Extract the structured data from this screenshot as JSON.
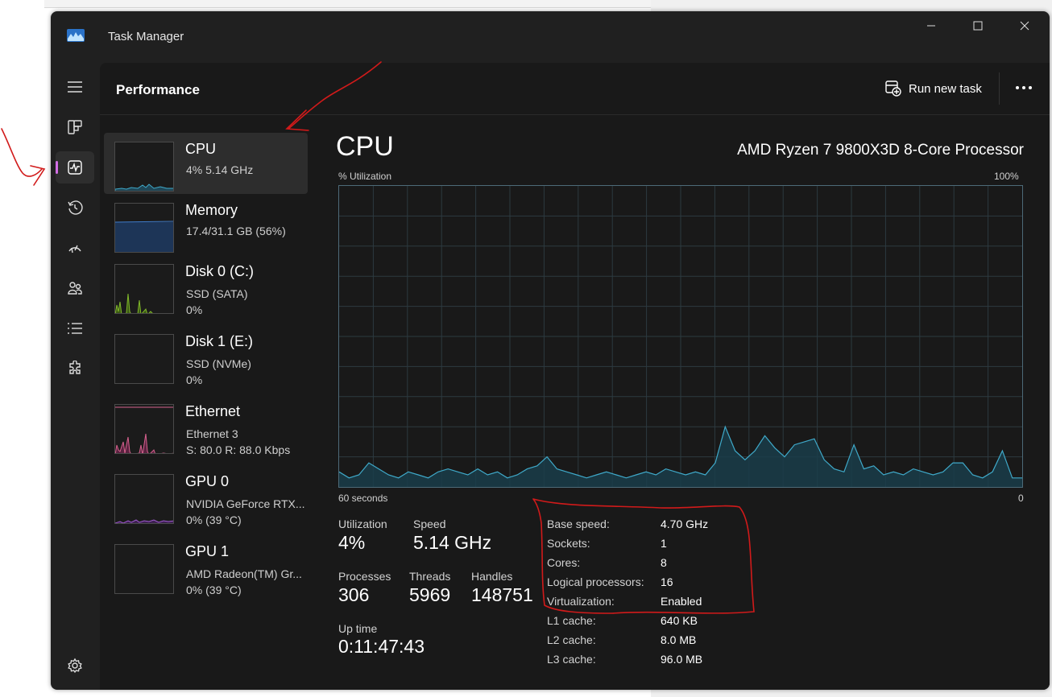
{
  "window": {
    "title": "Task Manager",
    "page_title": "Performance",
    "run_new_task": "Run new task"
  },
  "nav": {
    "items": [
      {
        "name": "menu",
        "icon": "hamburger-icon"
      },
      {
        "name": "processes",
        "icon": "processes-icon"
      },
      {
        "name": "performance",
        "icon": "performance-icon",
        "active": true
      },
      {
        "name": "app-history",
        "icon": "history-icon"
      },
      {
        "name": "startup-apps",
        "icon": "speedometer-icon"
      },
      {
        "name": "users",
        "icon": "users-icon"
      },
      {
        "name": "details",
        "icon": "list-icon"
      },
      {
        "name": "services",
        "icon": "puzzle-icon"
      },
      {
        "name": "settings",
        "icon": "gear-icon"
      }
    ]
  },
  "devices": [
    {
      "name": "CPU",
      "sub1": "4%  5.14 GHz",
      "sub2": "",
      "color": "#3fa9c9",
      "active": true
    },
    {
      "name": "Memory",
      "sub1": "17.4/31.1 GB (56%)",
      "sub2": "",
      "color": "#3f7ccb"
    },
    {
      "name": "Disk 0 (C:)",
      "sub1": "SSD (SATA)",
      "sub2": "0%",
      "color": "#80b82a"
    },
    {
      "name": "Disk 1 (E:)",
      "sub1": "SSD (NVMe)",
      "sub2": "0%",
      "color": "#80b82a"
    },
    {
      "name": "Ethernet",
      "sub1": "Ethernet 3",
      "sub2": "S: 80.0  R: 88.0 Kbps",
      "color": "#d6618e"
    },
    {
      "name": "GPU 0",
      "sub1": "NVIDIA GeForce RTX...",
      "sub2": "0%  (39 °C)",
      "color": "#a05ad0"
    },
    {
      "name": "GPU 1",
      "sub1": "AMD Radeon(TM) Gr...",
      "sub2": "0%  (39 °C)",
      "color": "#a05ad0"
    }
  ],
  "cpu": {
    "title": "CPU",
    "model": "AMD Ryzen 7 9800X3D 8-Core Processor",
    "graph_label": "% Utilization",
    "graph_max": "100%",
    "graph_time": "60 seconds",
    "graph_min": "0",
    "utilization_label": "Utilization",
    "utilization": "4%",
    "speed_label": "Speed",
    "speed": "5.14 GHz",
    "processes_label": "Processes",
    "processes": "306",
    "threads_label": "Threads",
    "threads": "5969",
    "handles_label": "Handles",
    "handles": "148751",
    "uptime_label": "Up time",
    "uptime": "0:11:47:43",
    "specs": [
      {
        "label": "Base speed:",
        "value": "4.70 GHz"
      },
      {
        "label": "Sockets:",
        "value": "1"
      },
      {
        "label": "Cores:",
        "value": "8"
      },
      {
        "label": "Logical processors:",
        "value": "16"
      },
      {
        "label": "Virtualization:",
        "value": "Enabled"
      },
      {
        "label": "L1 cache:",
        "value": "640 KB"
      },
      {
        "label": "L2 cache:",
        "value": "8.0 MB"
      },
      {
        "label": "L3 cache:",
        "value": "96.0 MB"
      }
    ]
  },
  "chart_data": {
    "type": "area",
    "ylabel": "% Utilization",
    "ylim": [
      0,
      100
    ],
    "x_seconds_ago": [
      60,
      0
    ],
    "values": [
      5,
      3,
      4,
      8,
      6,
      4,
      3,
      5,
      4,
      3,
      5,
      6,
      5,
      4,
      6,
      4,
      5,
      3,
      4,
      6,
      7,
      10,
      6,
      5,
      4,
      3,
      4,
      5,
      4,
      3,
      4,
      5,
      4,
      6,
      5,
      4,
      5,
      4,
      8,
      20,
      12,
      9,
      12,
      17,
      13,
      10,
      14,
      15,
      16,
      9,
      6,
      5,
      14,
      6,
      7,
      4,
      5,
      4,
      6,
      5,
      4,
      5,
      8,
      8,
      4,
      3,
      5,
      12,
      3,
      3
    ],
    "color": "#3fa9c9",
    "grid": true
  }
}
